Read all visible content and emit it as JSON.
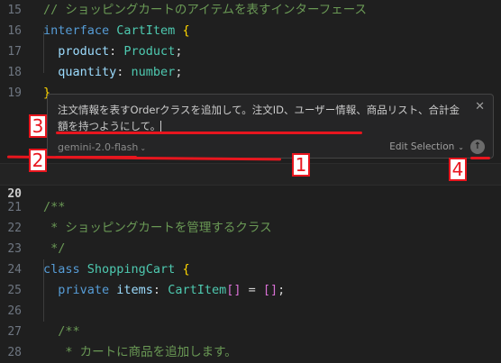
{
  "editor": {
    "lines": [
      {
        "num": "15",
        "tokens": [
          {
            "t": "// ショッピングカートのアイテムを表すインターフェース",
            "c": "comment"
          }
        ]
      },
      {
        "num": "16",
        "tokens": [
          {
            "t": "interface ",
            "c": "kw"
          },
          {
            "t": "CartItem",
            "c": "type"
          },
          {
            "t": " ",
            "c": "punc"
          },
          {
            "t": "{",
            "c": "brace"
          }
        ]
      },
      {
        "num": "17",
        "tokens": [
          {
            "t": "  product",
            "c": "prop"
          },
          {
            "t": ": ",
            "c": "punc"
          },
          {
            "t": "Product",
            "c": "type"
          },
          {
            "t": ";",
            "c": "punc"
          }
        ]
      },
      {
        "num": "18",
        "tokens": [
          {
            "t": "  quantity",
            "c": "prop"
          },
          {
            "t": ": ",
            "c": "punc"
          },
          {
            "t": "number",
            "c": "type"
          },
          {
            "t": ";",
            "c": "punc"
          }
        ]
      },
      {
        "num": "19",
        "tokens": [
          {
            "t": "}",
            "c": "brace"
          }
        ]
      }
    ],
    "current_line_num": "20",
    "lines_after": [
      {
        "num": "21",
        "tokens": [
          {
            "t": "/**",
            "c": "comment"
          }
        ]
      },
      {
        "num": "22",
        "tokens": [
          {
            "t": " * ショッピングカートを管理するクラス",
            "c": "comment"
          }
        ]
      },
      {
        "num": "23",
        "tokens": [
          {
            "t": " */",
            "c": "comment"
          }
        ]
      },
      {
        "num": "24",
        "tokens": [
          {
            "t": "class ",
            "c": "kw"
          },
          {
            "t": "ShoppingCart",
            "c": "type"
          },
          {
            "t": " ",
            "c": "punc"
          },
          {
            "t": "{",
            "c": "brace"
          }
        ]
      },
      {
        "num": "25",
        "tokens": [
          {
            "t": "  private ",
            "c": "kw"
          },
          {
            "t": "items",
            "c": "prop"
          },
          {
            "t": ": ",
            "c": "punc"
          },
          {
            "t": "CartItem",
            "c": "type"
          },
          {
            "t": "[]",
            "c": "brkt"
          },
          {
            "t": " = ",
            "c": "punc"
          },
          {
            "t": "[]",
            "c": "brkt"
          },
          {
            "t": ";",
            "c": "punc"
          }
        ]
      },
      {
        "num": "26",
        "tokens": []
      },
      {
        "num": "27",
        "tokens": [
          {
            "t": "  /**",
            "c": "comment"
          }
        ]
      },
      {
        "num": "28",
        "tokens": [
          {
            "t": "   * カートに商品を追加します。",
            "c": "comment"
          }
        ]
      }
    ]
  },
  "inline_chat": {
    "prompt_text": "注文情報を表すOrderクラスを追加して。注文ID、ユーザー情報、商品リスト、合計金額を持つようにして。",
    "close_glyph": "✕",
    "model_label": "gemini-2.0-flash",
    "model_chevron": "⌄",
    "edit_selection_label": "Edit Selection",
    "edit_chevron": "⌄",
    "send_glyph": "↑"
  },
  "annotations": {
    "labels": [
      "1",
      "2",
      "3",
      "4"
    ],
    "color": "#e8161e"
  }
}
